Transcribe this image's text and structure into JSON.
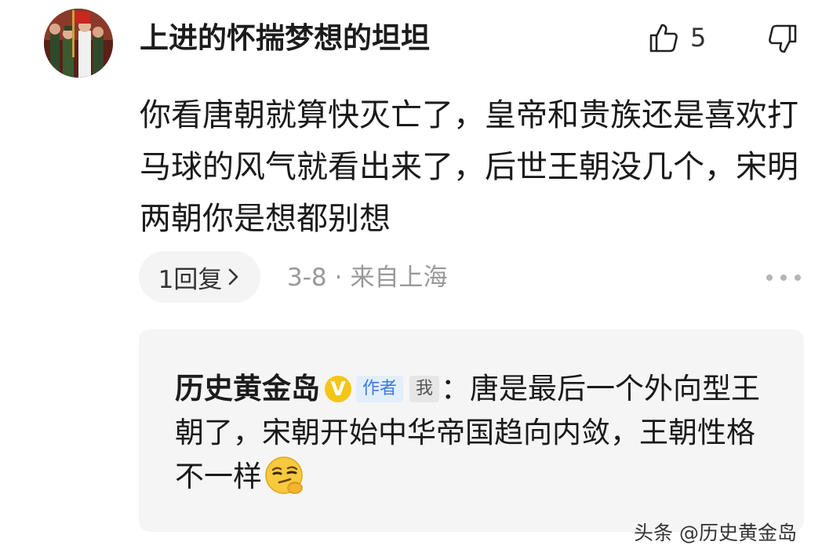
{
  "comment": {
    "username": "上进的怀揣梦想的坦坦",
    "like_count": "5",
    "text": "你看唐朝就算快灭亡了，皇帝和贵族还是喜欢打马球的风气就看出来了，后世王朝没几个，宋明两朝你是想都别想",
    "reply_button_label": "1回复",
    "date": "3-8",
    "separator": "·",
    "location": "来自上海",
    "avatar_icon": "avatar-soldiers-parade",
    "like_icon": "thumbs-up-icon",
    "dislike_icon": "thumbs-down-icon",
    "more_icon": "more-dots-icon"
  },
  "reply": {
    "author_name": "历史黄金岛",
    "verified_badge": "V",
    "verified_badge_color": "#f5c518",
    "author_tag": "作者",
    "me_tag": "我",
    "separator": "：",
    "text": "唐是最后一个外向型王朝了，宋朝开始中华帝国趋向内敛，王朝性格不一样",
    "emoji_icon": "smirk-thinking-emoji"
  },
  "watermark": {
    "text": "头条 @历史黄金岛"
  },
  "colors": {
    "meta_text": "#999999",
    "reply_box_bg": "#f5f5f5",
    "author_tag_bg": "#e3eefc",
    "author_tag_text": "#3b7ae0"
  }
}
